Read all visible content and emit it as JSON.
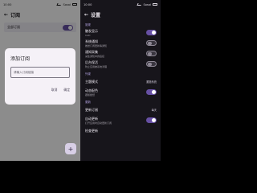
{
  "left": {
    "status": {
      "time": "10:00",
      "carrier": "Sosai"
    },
    "appbar": {
      "back_icon": "arrow-left-icon",
      "title": "订阅"
    },
    "list": [
      {
        "title": "全部订阅",
        "desc": ""
      }
    ],
    "dialog": {
      "title": "添加订阅",
      "input_placeholder": "请输入订阅链接",
      "cancel_label": "取消",
      "ok_label": "确定"
    },
    "fab_icon": "plus-icon"
  },
  "right": {
    "status": {
      "time": "10:00",
      "carrier": "Sosai"
    },
    "appbar": {
      "back_icon": "arrow-left-icon",
      "title": "设置"
    },
    "sections": [
      {
        "label": "常规",
        "items": [
          {
            "title": "触发显示",
            "desc": "CAD",
            "control": "toggle",
            "on": true
          },
          {
            "title": "系统通知",
            "desc": "推送订阅更新等通知",
            "control": "toggle",
            "on": false
          },
          {
            "title": "通知采集",
            "desc": "采集通知中的链接",
            "control": "toggle",
            "on": false
          },
          {
            "title": "后台保活",
            "desc": "防止应用被系统清理",
            "control": "toggle",
            "on": false
          }
        ]
      },
      {
        "label": "外观",
        "items": [
          {
            "title": "主题模式",
            "desc": "",
            "control": "value",
            "value": "跟随系统"
          },
          {
            "title": "动态配色",
            "desc": "跟随壁纸",
            "control": "toggle",
            "on": true
          }
        ]
      },
      {
        "label": "更新",
        "items": [
          {
            "title": "更新订阅",
            "desc": "",
            "control": "value",
            "value": "每天"
          },
          {
            "title": "自动更新",
            "desc": "打开应用时自动更新订阅",
            "control": "toggle",
            "on": true
          },
          {
            "title": "检查更新",
            "desc": "",
            "control": "none"
          }
        ]
      }
    ]
  }
}
